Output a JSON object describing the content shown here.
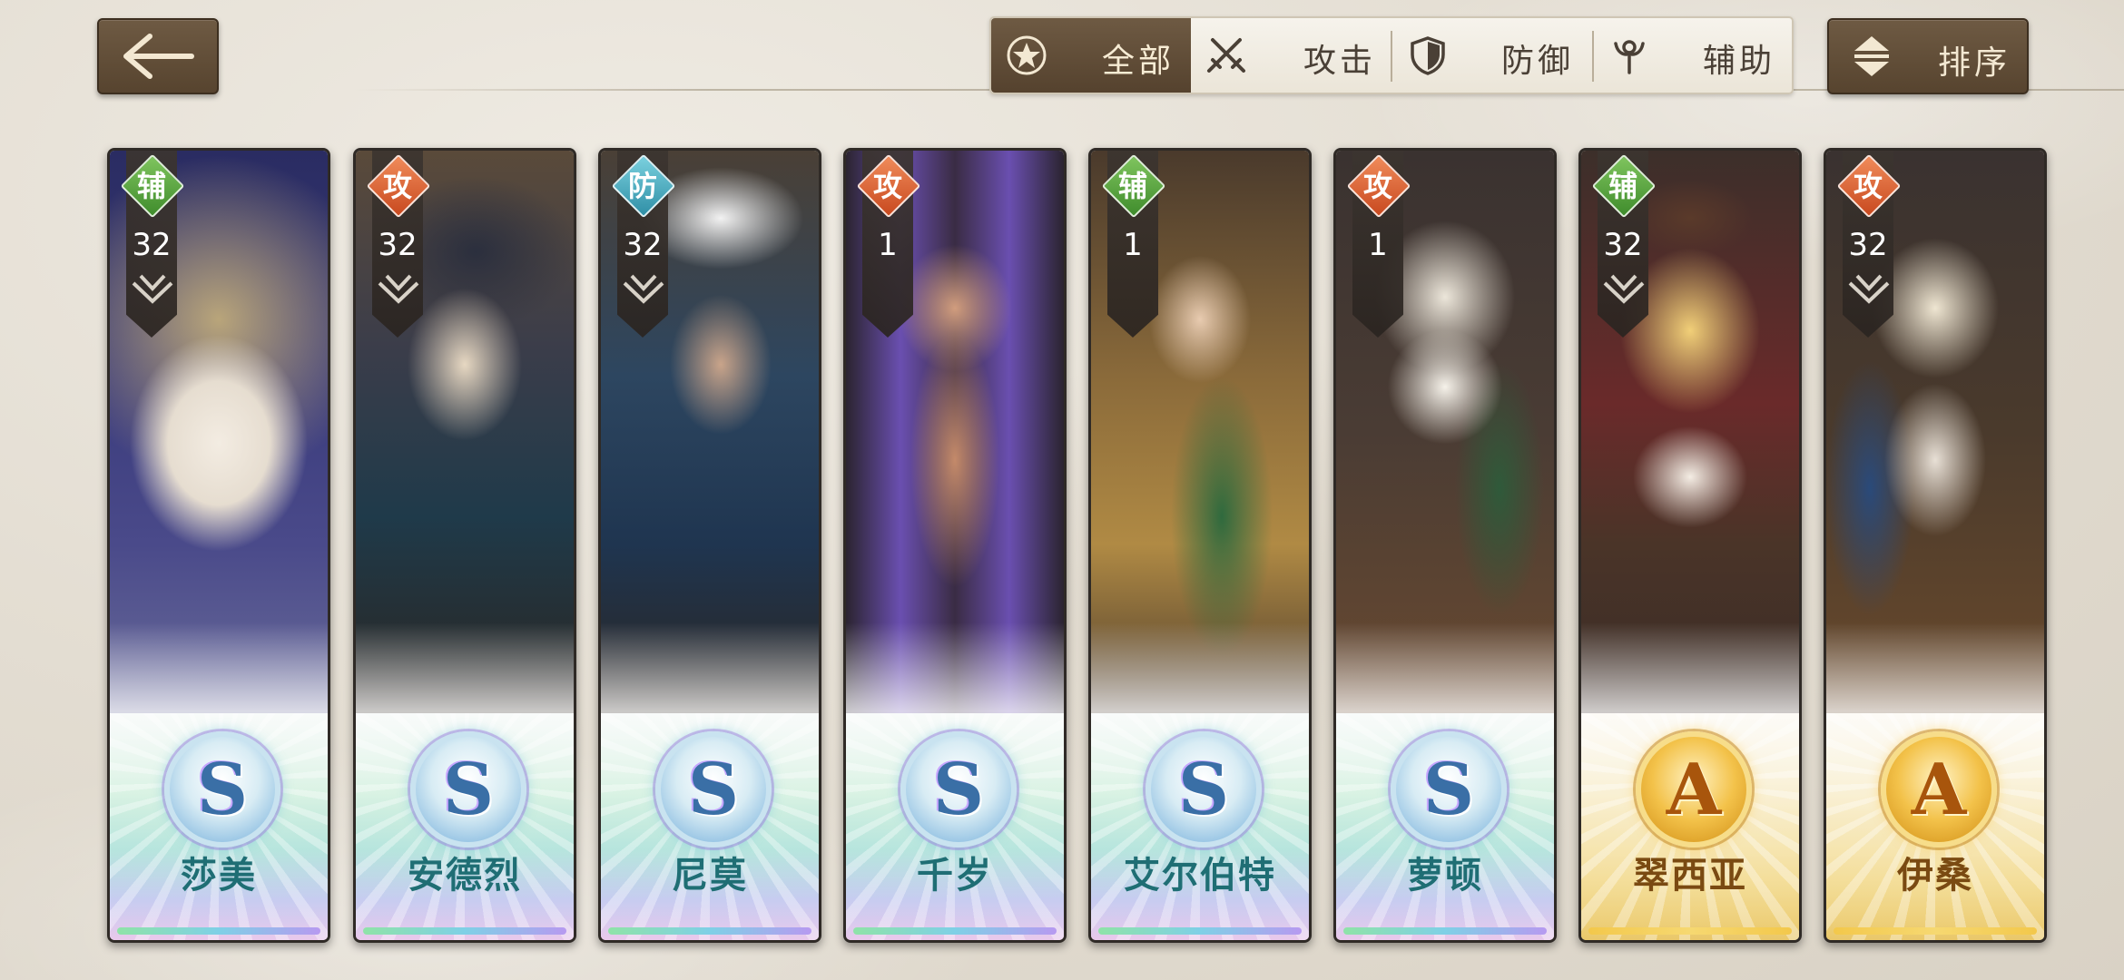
{
  "header": {
    "filter_tabs": [
      {
        "label": "全部",
        "icon": "star-circle-icon",
        "active": true
      },
      {
        "label": "攻击",
        "icon": "crossed-swords-icon",
        "active": false
      },
      {
        "label": "防御",
        "icon": "shield-icon",
        "active": false
      },
      {
        "label": "辅助",
        "icon": "staff-icon",
        "active": false
      }
    ],
    "sort_label": "排序"
  },
  "colors": {
    "button_brown": "#5e4a35",
    "support_green": "#5aa63f",
    "attack_orange": "#de6a37",
    "defense_teal": "#3fa5b8",
    "rank_s": "#3a6fa6",
    "rank_a": "#c7821a"
  },
  "characters": [
    {
      "name": "莎美",
      "role": "辅",
      "level": "32",
      "rank": "S"
    },
    {
      "name": "安德烈",
      "role": "攻",
      "level": "32",
      "rank": "S"
    },
    {
      "name": "尼莫",
      "role": "防",
      "level": "32",
      "rank": "S"
    },
    {
      "name": "千岁",
      "role": "攻",
      "level": "1",
      "rank": "S"
    },
    {
      "name": "艾尔伯特",
      "role": "辅",
      "level": "1",
      "rank": "S"
    },
    {
      "name": "萝顿",
      "role": "攻",
      "level": "1",
      "rank": "S"
    },
    {
      "name": "翠西亚",
      "role": "辅",
      "level": "32",
      "rank": "A"
    },
    {
      "name": "伊桑",
      "role": "攻",
      "level": "32",
      "rank": "A"
    }
  ]
}
